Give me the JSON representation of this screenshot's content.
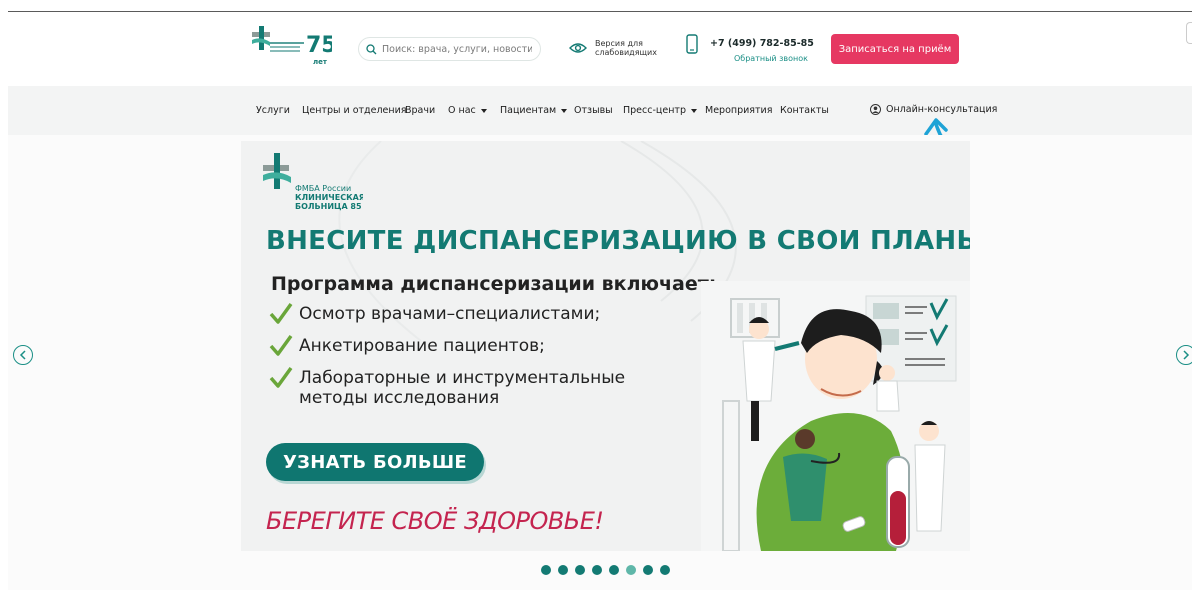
{
  "header": {
    "search_placeholder": "Поиск: врача, услуги, новости ...",
    "vision_label": "Версия для слабовидящих",
    "phone": "+7 (499) 782-85-85",
    "callback": "Обратный звонок",
    "book_button": "Записаться на приём",
    "logo_badge": "75",
    "logo_badge_sub": "лет"
  },
  "nav": {
    "items": [
      {
        "label": "Услуги"
      },
      {
        "label": "Центры и отделения"
      },
      {
        "label": "Врачи"
      },
      {
        "label": "О нас"
      },
      {
        "label": "Пациентам"
      },
      {
        "label": "Отзывы"
      },
      {
        "label": "Пресс-центр"
      },
      {
        "label": "Мероприятия"
      },
      {
        "label": "Контакты"
      }
    ],
    "online": "Онлайн-консультация"
  },
  "banner": {
    "logo_lines": [
      "ФМБА России",
      "КЛИНИЧЕСКАЯ",
      "БОЛЬНИЦА 85"
    ],
    "title": "ВНЕСИТЕ ДИСПАНСЕРИЗАЦИЮ В СВОИ ПЛАНЫ!",
    "subtitle": "Программа диспансеризации включает:",
    "items": [
      {
        "line1": "Осмотр врачами–специалистами;",
        "line2": ""
      },
      {
        "line1": "Анкетирование пациентов;",
        "line2": ""
      },
      {
        "line1": "Лабораторные и инструментальные",
        "line2": "методы исследования"
      }
    ],
    "button": "УЗНАТЬ БОЛЬШЕ",
    "slogan": "БЕРЕГИТЕ СВОЁ ЗДОРОВЬЕ!"
  },
  "slider": {
    "total": 8,
    "active_index": 5
  },
  "colors": {
    "brand_teal": "#137a73",
    "accent_pink": "#e63862",
    "slogan_red": "#c4244f",
    "highlight_arrow": "#1ea3d6"
  }
}
